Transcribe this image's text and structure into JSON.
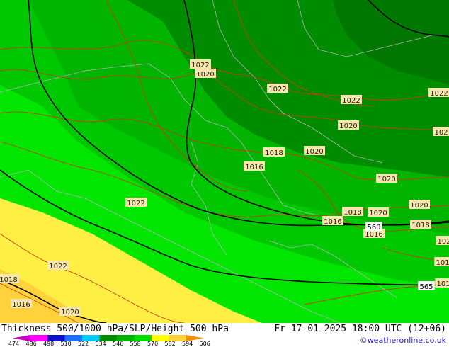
{
  "footer": {
    "title": "Thickness 500/1000 hPa/SLP/Height 500 hPa",
    "datetime": "Fr 17-01-2025 18:00 UTC (12+06)",
    "credit": "©weatheronline.co.uk"
  },
  "legend": {
    "values": [
      "474",
      "486",
      "498",
      "510",
      "522",
      "534",
      "546",
      "558",
      "570",
      "582",
      "594",
      "606"
    ],
    "colors": [
      "#c800c8",
      "#ff00ff",
      "#1010c8",
      "#1e6eff",
      "#00c8ff",
      "#008c00",
      "#00b400",
      "#00dc00",
      "#ffff00",
      "#ffd23c",
      "#ff8c00"
    ]
  },
  "slp_labels": [
    {
      "text": "1022"
    },
    {
      "text": "1020"
    },
    {
      "text": "1022"
    },
    {
      "text": "1022"
    },
    {
      "text": "1022"
    },
    {
      "text": "1020"
    },
    {
      "text": "102"
    },
    {
      "text": "1018"
    },
    {
      "text": "1020"
    },
    {
      "text": "1016"
    },
    {
      "text": "1020"
    },
    {
      "text": "1022"
    },
    {
      "text": "1018"
    },
    {
      "text": "1020"
    },
    {
      "text": "1020"
    },
    {
      "text": "1016"
    },
    {
      "text": "1016"
    },
    {
      "text": "1018"
    },
    {
      "text": "102"
    },
    {
      "text": "1022"
    },
    {
      "text": "101"
    },
    {
      "text": "1018"
    },
    {
      "text": "101"
    },
    {
      "text": "1016"
    },
    {
      "text": "1020"
    }
  ],
  "height_labels": [
    {
      "text": "560"
    },
    {
      "text": "565"
    }
  ],
  "colors": {
    "dark_green": "#007800",
    "mid_green": "#00a000",
    "green": "#00c800",
    "bright_green": "#00e600",
    "yellow": "#ffee44",
    "light_yellow": "#ffff66",
    "orange_yellow": "#ffd23c",
    "slp_contour": "#c83c14",
    "height_contour": "#000000",
    "border": "#b4b4b4"
  }
}
